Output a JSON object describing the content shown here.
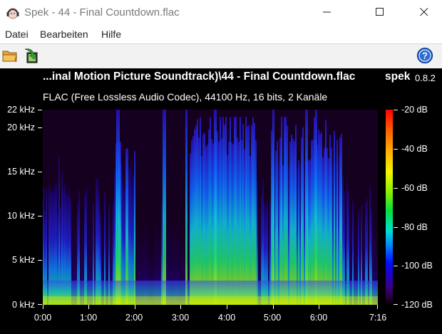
{
  "window": {
    "title": "Spek - 44 - Final Countdown.flac",
    "controls": {
      "minimize": "—",
      "maximize": "☐",
      "close": "✕"
    }
  },
  "menu": [
    "Datei",
    "Bearbeiten",
    "Hilfe"
  ],
  "toolbar": {
    "icons": [
      "open-folder-icon",
      "save-image-icon",
      "help-icon"
    ]
  },
  "viewer": {
    "file_title": "...inal Motion Picture Soundtrack)\\44 - Final Countdown.flac",
    "brand": "spek",
    "version": "0.8.2",
    "file_info": "FLAC (Free Lossless Audio Codec), 44100 Hz, 16 bits, 2 Kanäle",
    "freq_axis": [
      "22 kHz",
      "20 kHz",
      "15 kHz",
      "10 kHz",
      "5 kHz",
      "0 kHz"
    ],
    "freq_values_khz": [
      22,
      20,
      15,
      10,
      5,
      0
    ],
    "freq_max_khz": 22,
    "time_axis": [
      "0:00",
      "1:00",
      "2:00",
      "3:00",
      "4:00",
      "5:00",
      "6:00",
      "7:16"
    ],
    "time_values_s": [
      0,
      60,
      120,
      180,
      240,
      300,
      360,
      436
    ],
    "duration_s": 436,
    "db_axis": [
      "-20 dB",
      "-40 dB",
      "-60 dB",
      "-80 dB",
      "-100 dB",
      "-120 dB"
    ],
    "db_values": [
      -20,
      -40,
      -60,
      -80,
      -100,
      -120
    ],
    "db_range": [
      -120,
      -20
    ],
    "colors": {
      "background": "#000000",
      "quiet": "#160020",
      "loud": "#ff0000"
    }
  }
}
